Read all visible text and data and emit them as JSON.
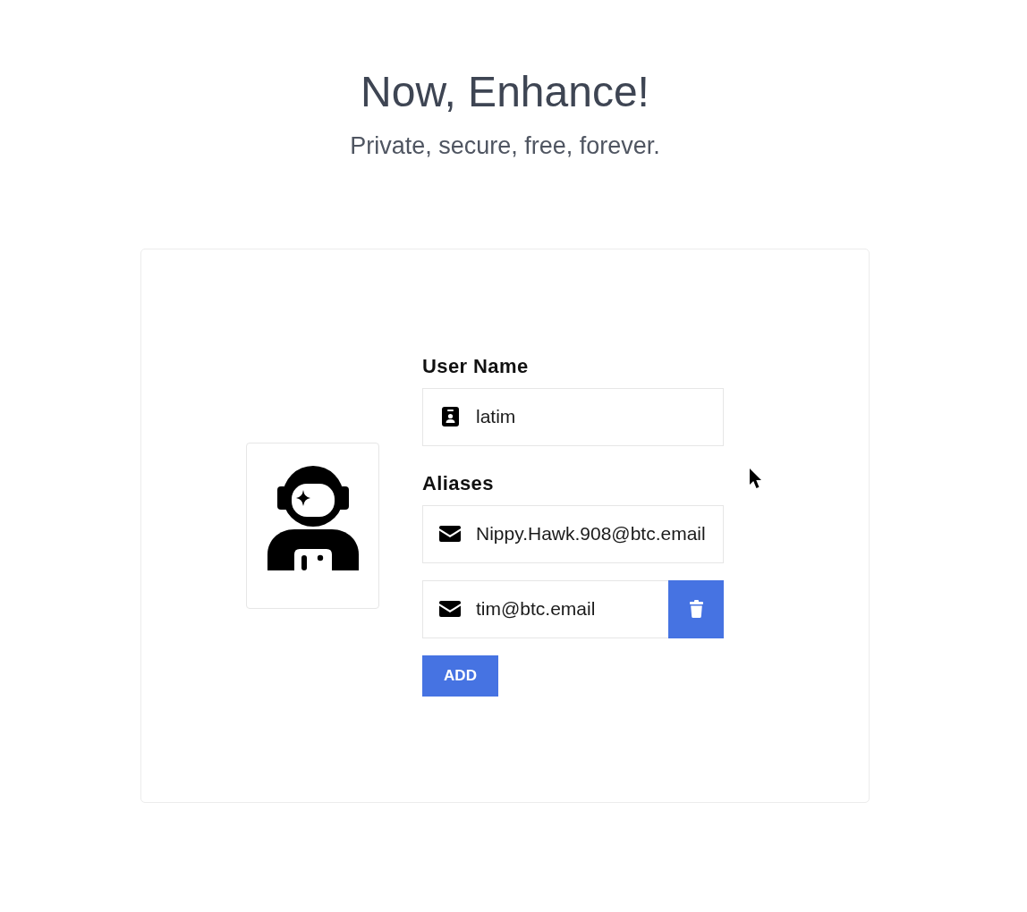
{
  "header": {
    "title": "Now, Enhance!",
    "subtitle": "Private, secure, free, forever."
  },
  "profile": {
    "username": {
      "label": "User Name",
      "value": "latim"
    },
    "aliases": {
      "label": "Aliases",
      "items": [
        {
          "value": "Nippy.Hawk.908@btc.email",
          "removable": false
        },
        {
          "value": "tim@btc.email",
          "removable": true
        }
      ]
    },
    "add_button": {
      "label": "ADD"
    }
  }
}
